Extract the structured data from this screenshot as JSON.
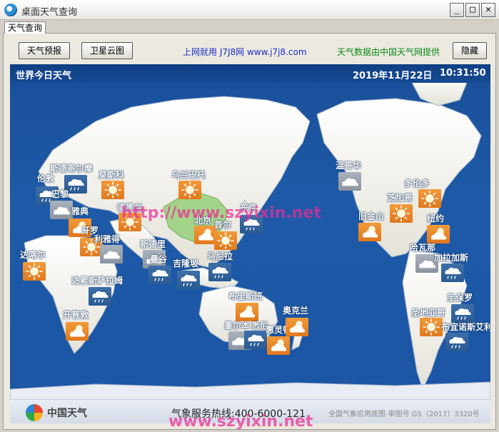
{
  "window": {
    "title": "桌面天气查询",
    "min": "_",
    "max": "□",
    "close": "✕"
  },
  "tab": {
    "label": "天气查询"
  },
  "toolbar": {
    "forecast_label": "天气预报",
    "cloud_label": "卫星云图",
    "site_link": "上网就用 J7J8网 www.j7j8.com",
    "source_text": "天气数据由中国天气网提供",
    "hide_label": "隐藏"
  },
  "map": {
    "title": "世界今日天气",
    "date": "2019年11月22日",
    "time": "10:31:50",
    "logo_text": "中国天气",
    "hotline": "气象服务热线:400-6000-121",
    "license": "全国气象应用底图-审图号 GS（2017）3320号",
    "watermark": "http://www.szyixin.net",
    "footer_watermark": "www.szyixin.net"
  },
  "cities": [
    {
      "name": "斯德哥尔摩",
      "weather": "rain",
      "icon": "rain-icon"
    },
    {
      "name": "伦敦",
      "weather": "rain",
      "icon": "rain-icon"
    },
    {
      "name": "莫斯科",
      "weather": "sunny",
      "icon": "sun-icon"
    },
    {
      "name": "巴黎",
      "weather": "cloudy",
      "icon": "cloud-icon"
    },
    {
      "name": "雅典",
      "weather": "cloudy-sun",
      "icon": "partly-cloudy-icon"
    },
    {
      "name": "德黑兰",
      "weather": "sunny",
      "icon": "sun-icon"
    },
    {
      "name": "开罗",
      "weather": "sunny",
      "icon": "sun-icon"
    },
    {
      "name": "利雅得",
      "weather": "cloudy",
      "icon": "cloud-icon"
    },
    {
      "name": "达喀尔",
      "weather": "sunny",
      "icon": "sun-icon"
    },
    {
      "name": "新德里",
      "weather": "cloudy",
      "icon": "cloud-icon"
    },
    {
      "name": "乌兰巴托",
      "weather": "sunny",
      "icon": "sun-icon"
    },
    {
      "name": "北京",
      "weather": "cloudy-sun",
      "icon": "partly-cloudy-icon"
    },
    {
      "name": "东京",
      "weather": "rain",
      "icon": "rain-icon"
    },
    {
      "name": "首尔",
      "weather": "sunny",
      "icon": "sun-icon"
    },
    {
      "name": "曼谷",
      "weather": "rain",
      "icon": "rain-icon"
    },
    {
      "name": "吉隆坡",
      "weather": "rain",
      "icon": "rain-icon"
    },
    {
      "name": "马尼拉",
      "weather": "rain",
      "icon": "rain-icon"
    },
    {
      "name": "达累斯萨拉姆",
      "weather": "rain",
      "icon": "rain-icon"
    },
    {
      "name": "开普敦",
      "weather": "cloudy-sun",
      "icon": "partly-cloudy-icon"
    },
    {
      "name": "布里斯班",
      "weather": "cloudy-sun",
      "icon": "partly-cloudy-icon"
    },
    {
      "name": "墨尔本",
      "weather": "cloudy",
      "icon": "cloud-icon"
    },
    {
      "name": "悉尼",
      "weather": "rain",
      "icon": "rain-icon"
    },
    {
      "name": "惠灵顿",
      "weather": "cloudy-sun",
      "icon": "partly-cloudy-icon"
    },
    {
      "name": "奥克兰",
      "weather": "cloudy-sun",
      "icon": "partly-cloudy-icon"
    },
    {
      "name": "温哥华",
      "weather": "cloudy",
      "icon": "cloud-icon"
    },
    {
      "name": "旧金山",
      "weather": "cloudy-sun",
      "icon": "partly-cloudy-icon"
    },
    {
      "name": "芝加哥",
      "weather": "sunny",
      "icon": "sun-icon"
    },
    {
      "name": "多伦多",
      "weather": "sunny",
      "icon": "sun-icon"
    },
    {
      "name": "纽约",
      "weather": "cloudy-sun",
      "icon": "partly-cloudy-icon"
    },
    {
      "name": "哈瓦那",
      "weather": "cloudy",
      "icon": "cloud-icon"
    },
    {
      "name": "加拉加斯",
      "weather": "rain",
      "icon": "rain-icon"
    },
    {
      "name": "圣保罗",
      "weather": "rain",
      "icon": "rain-icon"
    },
    {
      "name": "圣地亚哥",
      "weather": "sunny",
      "icon": "sun-icon"
    },
    {
      "name": "布宜诺斯艾利斯",
      "weather": "rain",
      "icon": "rain-icon"
    }
  ],
  "colors": {
    "ocean": "#1e5aa8",
    "land": "#f0efe8",
    "china": "#a4d38a",
    "sunny": "#e8862a",
    "cloudy": "#9aa3ae",
    "rain": "#2f609c",
    "watermark": "#ec2c96"
  }
}
